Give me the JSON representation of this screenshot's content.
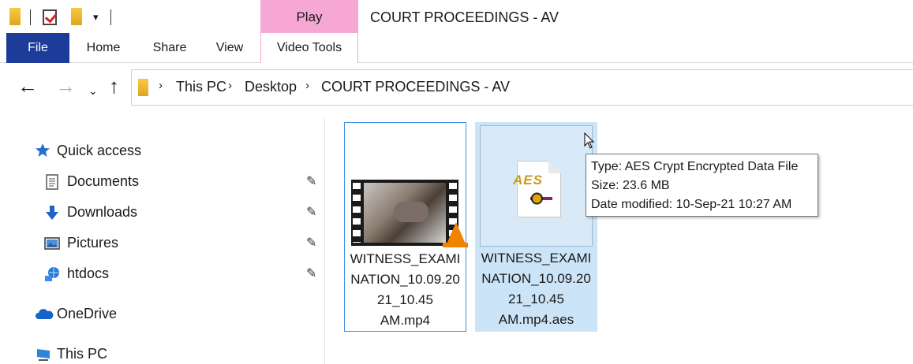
{
  "window": {
    "title": "COURT PROCEEDINGS - AV",
    "contextual_tab": "Play"
  },
  "qat": {
    "dropdown_glyph": "▾"
  },
  "ribbon": {
    "tabs": [
      "File",
      "Home",
      "Share",
      "View",
      "Video Tools"
    ]
  },
  "nav": {
    "back": "←",
    "forward": "→",
    "recent": "⌄",
    "up": "↑",
    "breadcrumb": [
      "This PC",
      "Desktop",
      "COURT PROCEEDINGS - AV"
    ],
    "separator": "›"
  },
  "navpane": {
    "quick_access": "Quick access",
    "items": [
      {
        "label": "Documents",
        "icon": "documents-icon"
      },
      {
        "label": "Downloads",
        "icon": "downloads-icon"
      },
      {
        "label": "Pictures",
        "icon": "pictures-icon"
      },
      {
        "label": "htdocs",
        "icon": "network-folder-icon"
      }
    ],
    "pin_glyph": "📌",
    "onedrive": "OneDrive",
    "this_pc": "This PC"
  },
  "files": [
    {
      "name_lines": [
        "WITNESS_EXAMI",
        "NATION_10.09.20",
        "21_10.45",
        "AM.mp4"
      ],
      "icon": "video-thumbnail-icon"
    },
    {
      "name_lines": [
        "WITNESS_EXAMI",
        "NATION_10.09.20",
        "21_10.45",
        "AM.mp4.aes"
      ],
      "icon": "aes-file-icon"
    }
  ],
  "aes_icon_text": "AES",
  "tooltip": {
    "type": "Type: AES Crypt Encrypted Data File",
    "size": "Size: 23.6 MB",
    "date": "Date modified: 10-Sep-21 10:27 AM"
  },
  "colors": {
    "file_tab": "#1d3b99",
    "play_tab": "#f6a7d4",
    "selection": "#cce4f7",
    "tile_border": "#3d8ee0"
  }
}
